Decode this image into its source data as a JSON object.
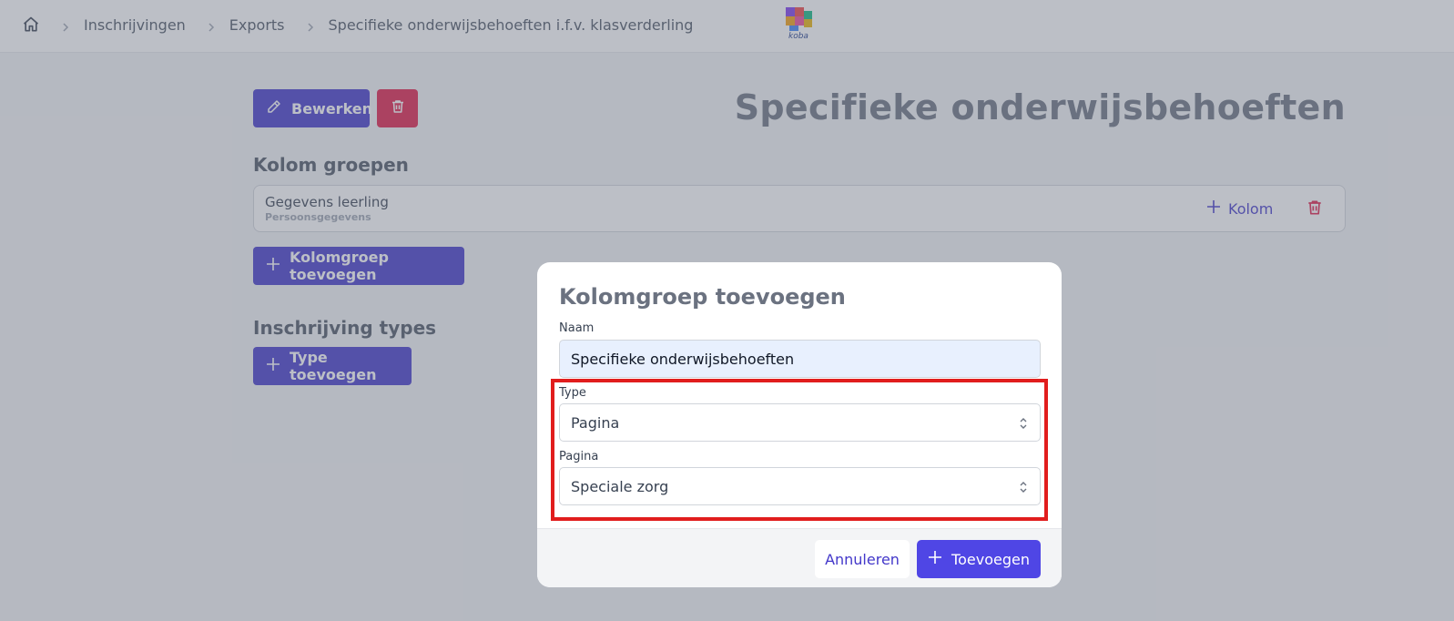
{
  "breadcrumb": {
    "items": [
      "Inschrijvingen",
      "Exports",
      "Specifieke onderwijsbehoeften i.f.v. klasverderling"
    ]
  },
  "logo": {
    "text": "koba"
  },
  "toolbar": {
    "edit_label": "Bewerken"
  },
  "page_title": "Specifieke onderwijsbehoeften",
  "kolom_groepen": {
    "title": "Kolom groepen",
    "groups": [
      {
        "name": "Gegevens leerling",
        "subtitle": "Persoonsgegevens",
        "add_column_label": "Kolom"
      }
    ],
    "add_label": "Kolomgroep toevoegen"
  },
  "inschrijving_types": {
    "title": "Inschrijving types",
    "add_label": "Type toevoegen"
  },
  "modal": {
    "title": "Kolomgroep toevoegen",
    "naam_label": "Naam",
    "naam_value": "Specifieke onderwijsbehoeften",
    "type_label": "Type",
    "type_value": "Pagina",
    "pagina_label": "Pagina",
    "pagina_value": "Speciale zorg",
    "cancel_label": "Annuleren",
    "submit_label": "Toevoegen"
  },
  "colors": {
    "primary": "#4338ca",
    "danger": "#e11d48",
    "highlight": "#e11d1d"
  },
  "icons": [
    "home-icon",
    "chevron-right-icon",
    "pencil-icon",
    "trash-icon",
    "plus-icon",
    "chevron-up-down-icon"
  ]
}
